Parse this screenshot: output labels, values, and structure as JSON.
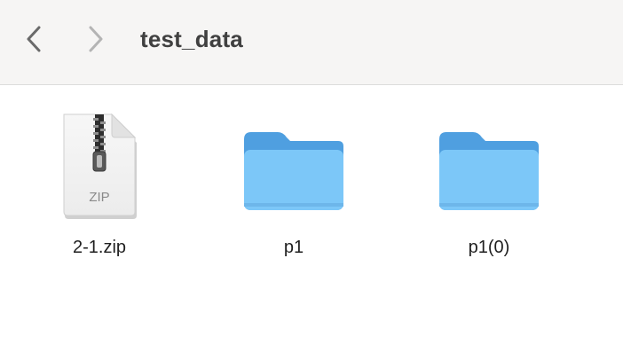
{
  "toolbar": {
    "title": "test_data",
    "back_icon": "chevron-left-icon",
    "forward_icon": "chevron-right-icon"
  },
  "files": [
    {
      "name": "2-1.zip",
      "kind": "zip",
      "badge": "ZIP"
    },
    {
      "name": "p1",
      "kind": "folder"
    },
    {
      "name": "p1(0)",
      "kind": "folder"
    }
  ],
  "colors": {
    "folder_back": "#5aa9e6",
    "folder_front": "#7cc5f7",
    "toolbar_bg": "#f6f5f4"
  }
}
